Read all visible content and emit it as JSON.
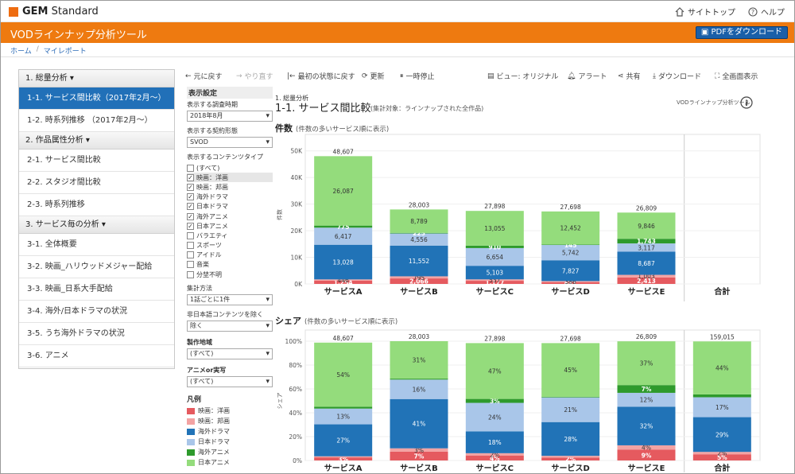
{
  "brand": {
    "name_bold": "GEM",
    "name_rest": " Standard"
  },
  "toplinks": {
    "site_top": "サイトトップ",
    "help": "ヘルプ"
  },
  "app": {
    "title": "VODラインナップ分析ツール",
    "pdf_button": "PDFをダウンロード"
  },
  "breadcrumb": [
    "ホーム",
    "マイレポート"
  ],
  "sidebar": {
    "sections": [
      {
        "header": "1. 総量分析",
        "items": [
          "1-1. サービス間比較（2017年2月〜）",
          "1-2. 時系列推移 （2017年2月〜）"
        ]
      },
      {
        "header": "2. 作品属性分析",
        "items": [
          "2-1. サービス間比較",
          "2-2. スタジオ間比較",
          "2-3. 時系列推移"
        ]
      },
      {
        "header": "3. サービス毎の分析",
        "items": [
          "3-1. 全体概要",
          "3-2. 映画_ハリウッドメジャー配給",
          "3-3. 映画_日系大手配給",
          "3-4. 海外/日本ドラマの状況",
          "3-5. うち海外ドラマの状況",
          "3-6. アニメ"
        ]
      }
    ]
  },
  "toolbar": {
    "undo": "元に戻す",
    "redo": "やり直す",
    "reset": "最初の状態に戻す",
    "refresh": "更新",
    "pause": "一時停止",
    "view": "ビュー: オリジナル",
    "alert": "アラート",
    "share": "共有",
    "download": "ダウンロード",
    "fullscreen": "全画面表示"
  },
  "controls": {
    "title": "表示設定",
    "period_label": "表示する調査時期",
    "period_value": "2018年8月",
    "contract_label": "表示する契約形態",
    "contract_value": "SVOD",
    "content_label": "表示するコンテンツタイプ",
    "content_types": [
      {
        "label": "(すべて)",
        "checked": false
      },
      {
        "label": "映画：洋画",
        "checked": true
      },
      {
        "label": "映画：邦画",
        "checked": true
      },
      {
        "label": "海外ドラマ",
        "checked": true
      },
      {
        "label": "日本ドラマ",
        "checked": true
      },
      {
        "label": "海外アニメ",
        "checked": true
      },
      {
        "label": "日本アニメ",
        "checked": true
      },
      {
        "label": "バラエティ",
        "checked": false
      },
      {
        "label": "スポーツ",
        "checked": false
      },
      {
        "label": "アイドル",
        "checked": false
      },
      {
        "label": "音楽",
        "checked": false
      },
      {
        "label": "分埜不明",
        "checked": false
      }
    ],
    "agg_label": "集計方法",
    "agg_value": "1話ごとに1件",
    "nonjp_label": "非日本語コンテンツを除く",
    "nonjp_value": "除く",
    "region_label": "製作地域",
    "region_value": "(すべて)",
    "anime_label": "アニメor実写",
    "anime_value": "(すべて)",
    "legend_title": "凡例"
  },
  "colors": {
    "yoga": "#e55a5f",
    "hoga": "#f3a3a3",
    "kaigai_drama": "#2173b7",
    "nihon_drama": "#a9c6e9",
    "kaigai_anime": "#2e9a2c",
    "nihon_anime": "#94dc7c",
    "orange": "#ee7a10"
  },
  "report": {
    "section": "1. 総量分析",
    "title": "1-1. サービス間比較",
    "subtitle": "(集計対象：ラインナップされた全作品)",
    "tool_name": "VODラインナップ分析ツール"
  },
  "chart_data": [
    {
      "type": "bar",
      "title": "件数",
      "subtitle": "(件数の多いサービス順に表示)",
      "ylabel": "件数",
      "ylim": [
        0,
        52000
      ],
      "yticks": [
        "0K",
        "10K",
        "20K",
        "30K",
        "40K",
        "50K"
      ],
      "categories": [
        "サービスA",
        "サービスB",
        "サービスC",
        "サービスD",
        "サービスE",
        "合計"
      ],
      "totals": [
        "48,607",
        "28,003",
        "27,898",
        "27,698",
        "26,809",
        ""
      ],
      "series": [
        {
          "name": "映画：洋画",
          "values": [
            1254,
            2066,
            1177,
            681,
            2413,
            null
          ],
          "labels": [
            "1,254",
            "2,066",
            "1,177",
            "681",
            "2,413",
            ""
          ]
        },
        {
          "name": "映画：邦画",
          "values": [
            446,
            795,
            537,
            386,
            1003,
            null
          ],
          "labels": [
            "446",
            "795",
            "537",
            "386",
            "1,003",
            ""
          ]
        },
        {
          "name": "海外ドラマ",
          "values": [
            13028,
            11552,
            5103,
            7827,
            8687,
            null
          ],
          "labels": [
            "13,028",
            "11,552",
            "5,103",
            "7,827",
            "8,687",
            ""
          ]
        },
        {
          "name": "日本ドラマ",
          "values": [
            6417,
            4556,
            6654,
            5742,
            3117,
            null
          ],
          "labels": [
            "6,417",
            "4,556",
            "6,654",
            "5,742",
            "3,117",
            ""
          ]
        },
        {
          "name": "海外アニメ",
          "values": [
            775,
            225,
            910,
            145,
            1743,
            null
          ],
          "labels": [
            "775",
            "225",
            "910",
            "145",
            "1,743",
            ""
          ]
        },
        {
          "name": "日本アニメ",
          "values": [
            26087,
            8789,
            13055,
            12452,
            9846,
            null
          ],
          "labels": [
            "26,087",
            "8,789",
            "13,055",
            "12,452",
            "9,846",
            ""
          ]
        }
      ]
    },
    {
      "type": "bar",
      "title": "シェア",
      "subtitle": "(件数の多いサービス順に表示)",
      "ylabel": "シェア",
      "ylim": [
        0,
        100
      ],
      "yticks": [
        "0%",
        "20%",
        "40%",
        "60%",
        "80%",
        "100%"
      ],
      "categories": [
        "サービスA",
        "サービスB",
        "サービスC",
        "サービスD",
        "サービスE",
        "合計"
      ],
      "totals": [
        "48,607",
        "28,003",
        "27,898",
        "27,698",
        "26,809",
        "159,015"
      ],
      "series": [
        {
          "name": "映画：洋画",
          "values": [
            2.6,
            7.4,
            4.2,
            2.5,
            9.0,
            5.2
          ],
          "labels": [
            "3%",
            "7%",
            "4%",
            "2%",
            "9%",
            "5%"
          ]
        },
        {
          "name": "映画：邦画",
          "values": [
            0.9,
            2.8,
            1.9,
            1.4,
            3.7,
            2.0
          ],
          "labels": [
            "",
            "3%",
            "2%",
            "",
            "4%",
            "2%"
          ]
        },
        {
          "name": "海外ドラマ",
          "values": [
            26.8,
            41.3,
            18.3,
            28.3,
            32.4,
            29.1
          ],
          "labels": [
            "27%",
            "41%",
            "18%",
            "28%",
            "32%",
            "29%"
          ]
        },
        {
          "name": "日本ドラマ",
          "values": [
            13.2,
            16.3,
            23.9,
            20.7,
            11.6,
            16.7
          ],
          "labels": [
            "13%",
            "16%",
            "24%",
            "21%",
            "12%",
            "17%"
          ]
        },
        {
          "name": "海外アニメ",
          "values": [
            1.6,
            0.8,
            3.3,
            0.5,
            6.5,
            2.4
          ],
          "labels": [
            "",
            "",
            "3%",
            "",
            "7%",
            ""
          ]
        },
        {
          "name": "日本アニメ",
          "values": [
            53.7,
            31.4,
            46.8,
            45.0,
            36.7,
            44.4
          ],
          "labels": [
            "54%",
            "31%",
            "47%",
            "45%",
            "37%",
            "44%"
          ]
        }
      ]
    }
  ]
}
